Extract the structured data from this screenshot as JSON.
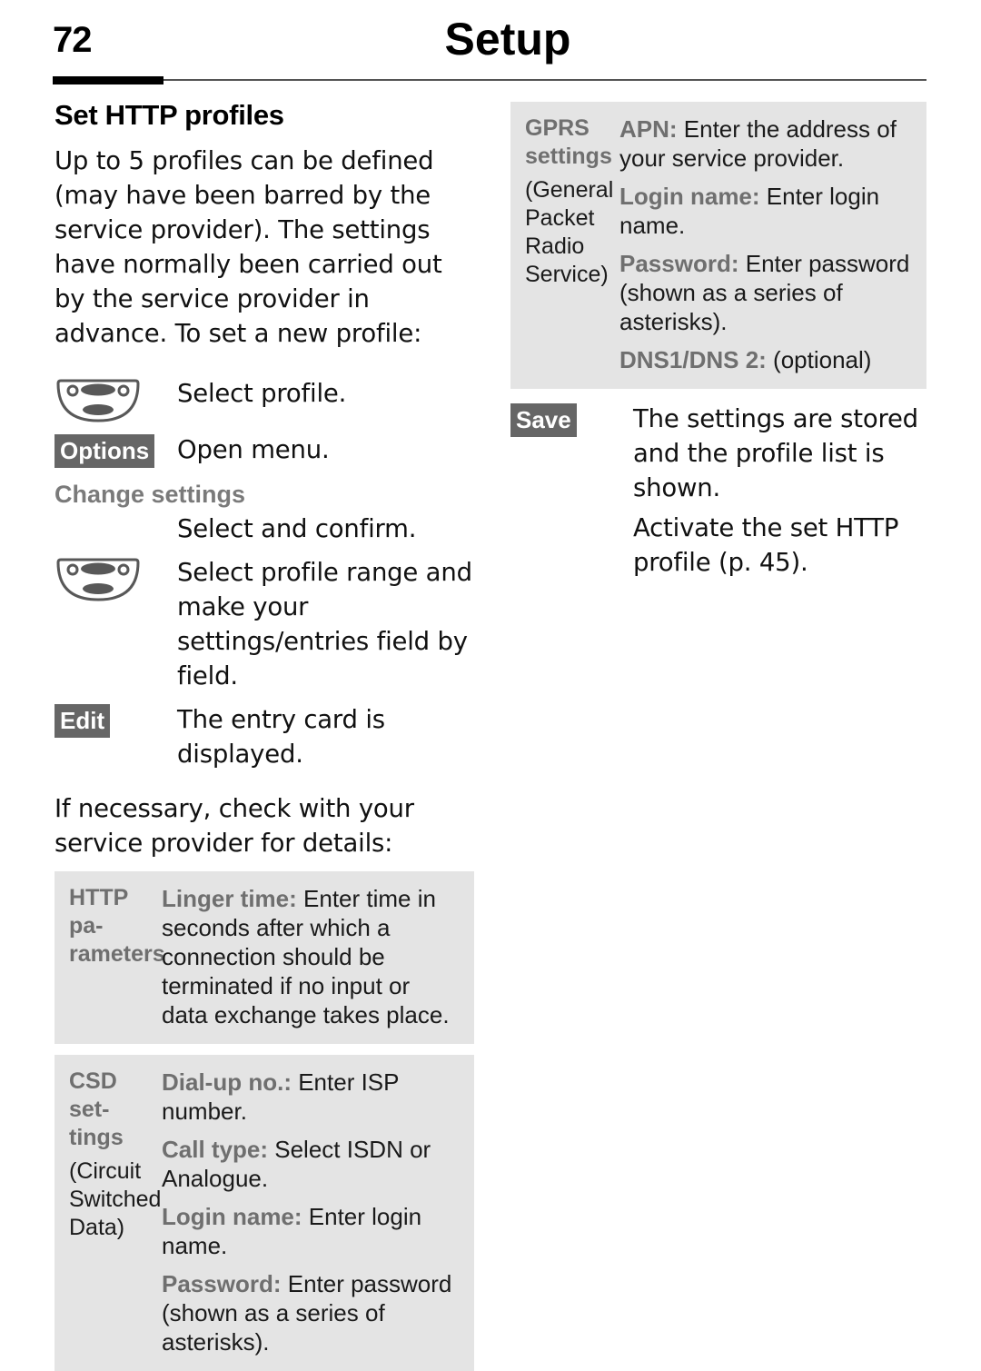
{
  "header": {
    "page_number": "72",
    "title": "Setup"
  },
  "left_column": {
    "section_title": "Set HTTP profiles",
    "intro_paragraph": "Up to 5 profiles can be defined (may have been barred by the service provider). The settings have normally been carried out by the service provider in advance. To set a new profile:",
    "steps": [
      {
        "key_type": "nav-key",
        "key_label": "",
        "description": "Select profile."
      },
      {
        "key_type": "softkey",
        "key_label": "Options",
        "description": "Open menu."
      }
    ],
    "subheading": "Change settings",
    "steps2": [
      {
        "key_type": "none",
        "key_label": "",
        "description": "Select and confirm."
      },
      {
        "key_type": "nav-key",
        "key_label": "",
        "description": "Select profile range and make your settings/entries field by field."
      },
      {
        "key_type": "softkey",
        "key_label": "Edit",
        "description": "The entry card is displayed."
      }
    ],
    "note_paragraph": "If necessary, check with your service provider for details:",
    "tables": [
      {
        "label_strong": "HTTP pa-rameters",
        "label_sub": "",
        "entries": [
          {
            "term": "Linger time:",
            "text": " Enter time in seconds after which a connection should be terminated if no input or data exchange takes place."
          }
        ]
      },
      {
        "label_strong": "CSD set-tings",
        "label_sub": "(Circuit Switched Data)",
        "entries": [
          {
            "term": "Dial-up no.:",
            "text": " Enter ISP number."
          },
          {
            "term": "Call type:",
            "text": " Select ISDN or Analogue."
          },
          {
            "term": "Login name:",
            "text": " Enter login name."
          },
          {
            "term": "Password:",
            "text": " Enter password (shown as a series of asterisks)."
          }
        ]
      }
    ]
  },
  "right_column": {
    "tables": [
      {
        "label_strong": "GPRS settings",
        "label_sub": "(General Packet Radio Service)",
        "entries": [
          {
            "term": "APN:",
            "text": " Enter the address of your service provider."
          },
          {
            "term": "Login name:",
            "text": " Enter login name."
          },
          {
            "term": "Password:",
            "text": " Enter password (shown as a series of asterisks)."
          },
          {
            "term": "DNS1/DNS 2:",
            "text": " (optional)"
          }
        ]
      }
    ],
    "steps": [
      {
        "key_type": "softkey",
        "key_label": "Save",
        "description": "The settings are stored and the profile list is shown."
      },
      {
        "key_type": "none",
        "key_label": "",
        "description": "Activate the set HTTP profile (p. 45)."
      }
    ]
  },
  "colors": {
    "table_background": "#e4e4e4",
    "softkey_background": "#666666",
    "term_gray": "#6f6f6f",
    "subhead_gray": "#7a7a7a"
  }
}
